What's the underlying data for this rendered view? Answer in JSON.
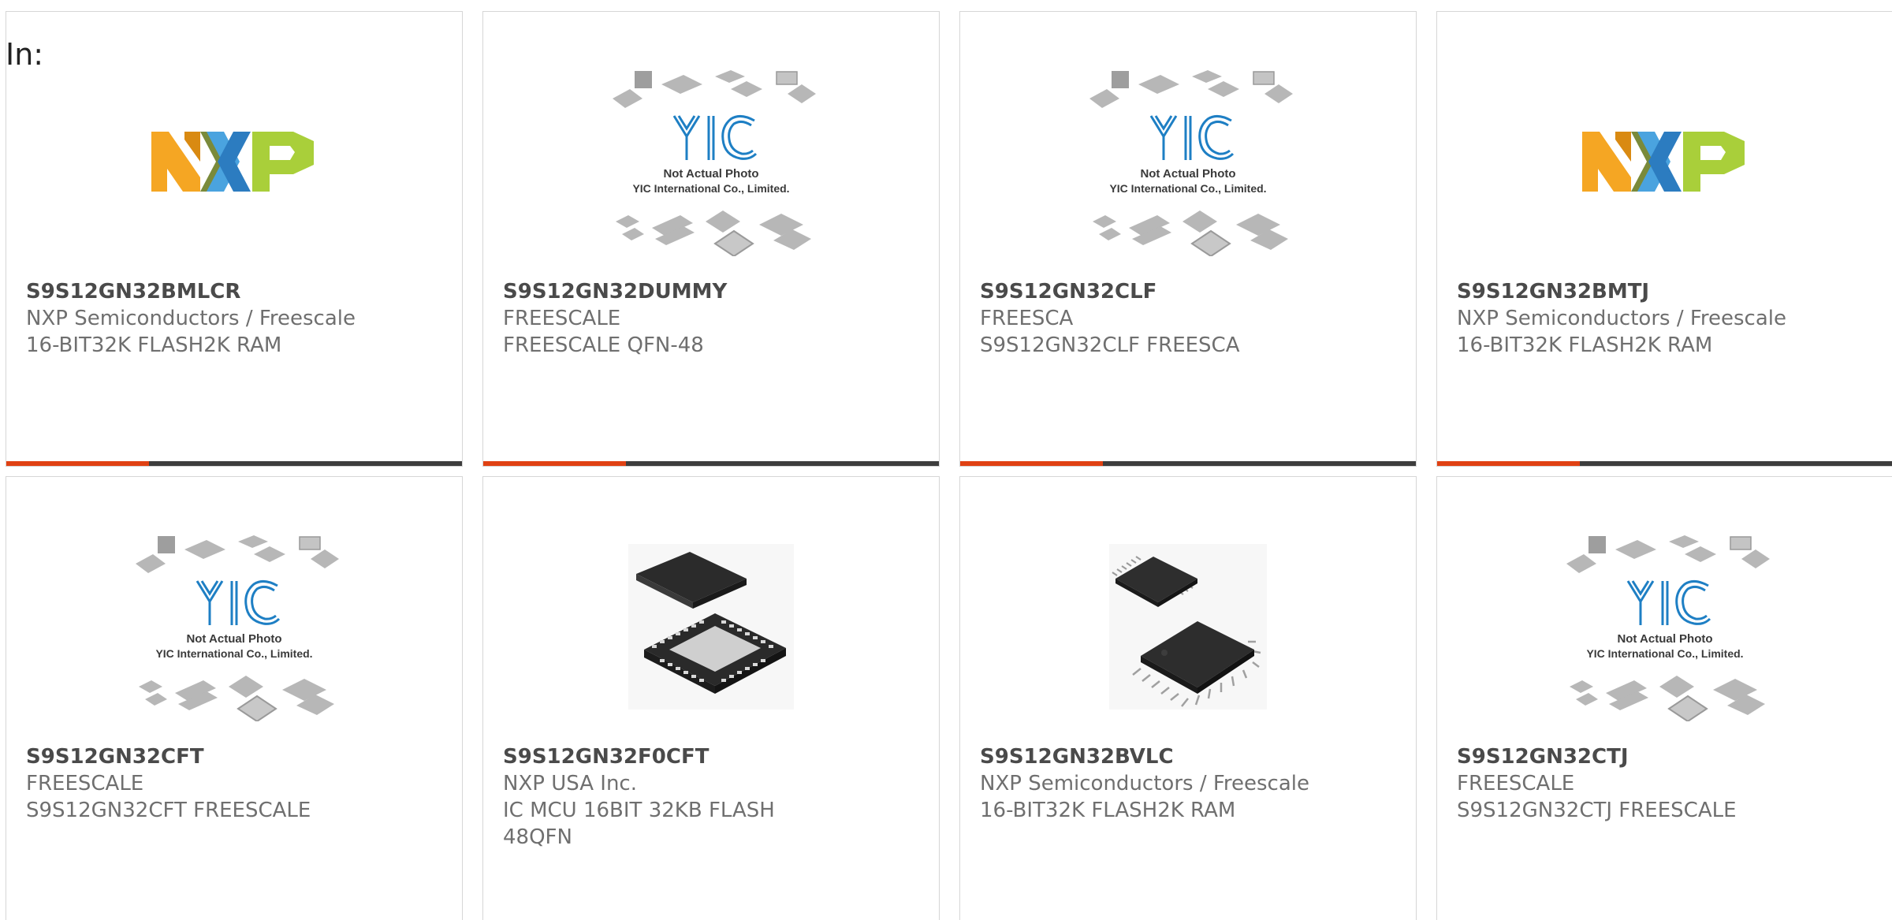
{
  "header": {
    "in_label": "In:"
  },
  "colors": {
    "accent_bar": "#e04113",
    "dark_bar": "#3d3d3d",
    "card_border": "#d6d6d6",
    "part_text": "#4a4a4a",
    "meta_text": "#6f6f6f",
    "yic_blue": "#1e7fc4"
  },
  "image_caption": {
    "line1": "Not Actual Photo",
    "line2": "YIC International Co., Limited."
  },
  "products": [
    {
      "part": "S9S12GN32BMLCR",
      "maker": "NXP Semiconductors / Freescale",
      "desc": "16-BIT32K FLASH2K RAM",
      "image": "nxp-logo"
    },
    {
      "part": "S9S12GN32DUMMY",
      "maker": "FREESCALE",
      "desc": "FREESCALE QFN-48",
      "image": "yic-placeholder"
    },
    {
      "part": "S9S12GN32CLF",
      "maker": "FREESCA",
      "desc": "S9S12GN32CLF FREESCA",
      "image": "yic-placeholder"
    },
    {
      "part": "S9S12GN32BMTJ",
      "maker": "NXP Semiconductors / Freescale",
      "desc": "16-BIT32K FLASH2K RAM",
      "image": "nxp-logo"
    },
    {
      "part": "S9S12GN32CFT",
      "maker": "FREESCALE",
      "desc": "S9S12GN32CFT FREESCALE",
      "image": "yic-placeholder"
    },
    {
      "part": "S9S12GN32F0CFT",
      "maker": "NXP USA Inc.",
      "desc": "IC MCU 16BIT 32KB FLASH 48QFN",
      "image": "qfn-chip-photo"
    },
    {
      "part": "S9S12GN32BVLC",
      "maker": "NXP Semiconductors / Freescale",
      "desc": "16-BIT32K FLASH2K RAM",
      "image": "lqfp-chip-photo"
    },
    {
      "part": "S9S12GN32CTJ",
      "maker": "FREESCALE",
      "desc": "S9S12GN32CTJ FREESCALE",
      "image": "yic-placeholder"
    }
  ]
}
